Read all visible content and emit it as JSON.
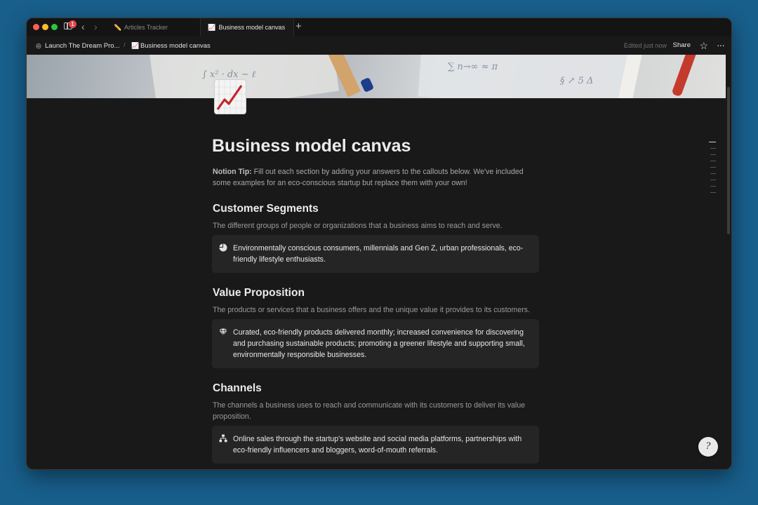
{
  "window": {
    "notifications_badge": "1",
    "tabs": [
      {
        "icon": "pencil-emoji",
        "icon_glyph": "✏️",
        "label": "Articles Tracker"
      },
      {
        "icon": "chart-increasing-emoji",
        "icon_glyph": "📈",
        "label": "Business model canvas"
      }
    ],
    "new_tab": "+"
  },
  "topbar": {
    "breadcrumbs": [
      {
        "icon": "target-icon",
        "icon_glyph": "◎",
        "label": "Launch The Dream Pro..."
      },
      {
        "icon": "chart-increasing-emoji",
        "icon_glyph": "📈",
        "label": "Business model canvas"
      }
    ],
    "separator": "/",
    "edited": "Edited just now",
    "share": "Share",
    "star_glyph": "☆",
    "more_glyph": "···"
  },
  "page": {
    "title": "Business model canvas",
    "tip_label": "Notion Tip:",
    "tip_text": " Fill out each section by adding your answers to the callouts below. We've included some examples for an eco-conscious startup but replace them with your own!",
    "sections": [
      {
        "heading": "Customer Segments",
        "description": "The different groups of people or organizations that a business aims to reach and serve.",
        "callout_icon": "pie-chart-icon",
        "callout": "Environmentally conscious consumers, millennials and Gen Z, urban professionals, eco-friendly lifestyle enthusiasts."
      },
      {
        "heading": "Value Proposition",
        "description": "The products or services that a business offers and the unique value it provides to its customers.",
        "callout_icon": "diamond-icon",
        "callout": "Curated, eco-friendly products delivered monthly; increased convenience for discovering and purchasing sustainable products; promoting a greener lifestyle and supporting small, environmentally responsible businesses."
      },
      {
        "heading": "Channels",
        "description": "The channels a business uses to reach and communicate with its customers to deliver its value proposition.",
        "callout_icon": "hierarchy-icon",
        "callout": "Online sales through the startup's website and social media platforms, partnerships with eco-friendly influencers and bloggers, word-of-mouth referrals."
      }
    ]
  },
  "help_glyph": "?",
  "colors": {
    "desktop": "#185f8c",
    "window_bg": "#191919",
    "callout_bg": "#252525",
    "chart_red": "#c0262d"
  }
}
